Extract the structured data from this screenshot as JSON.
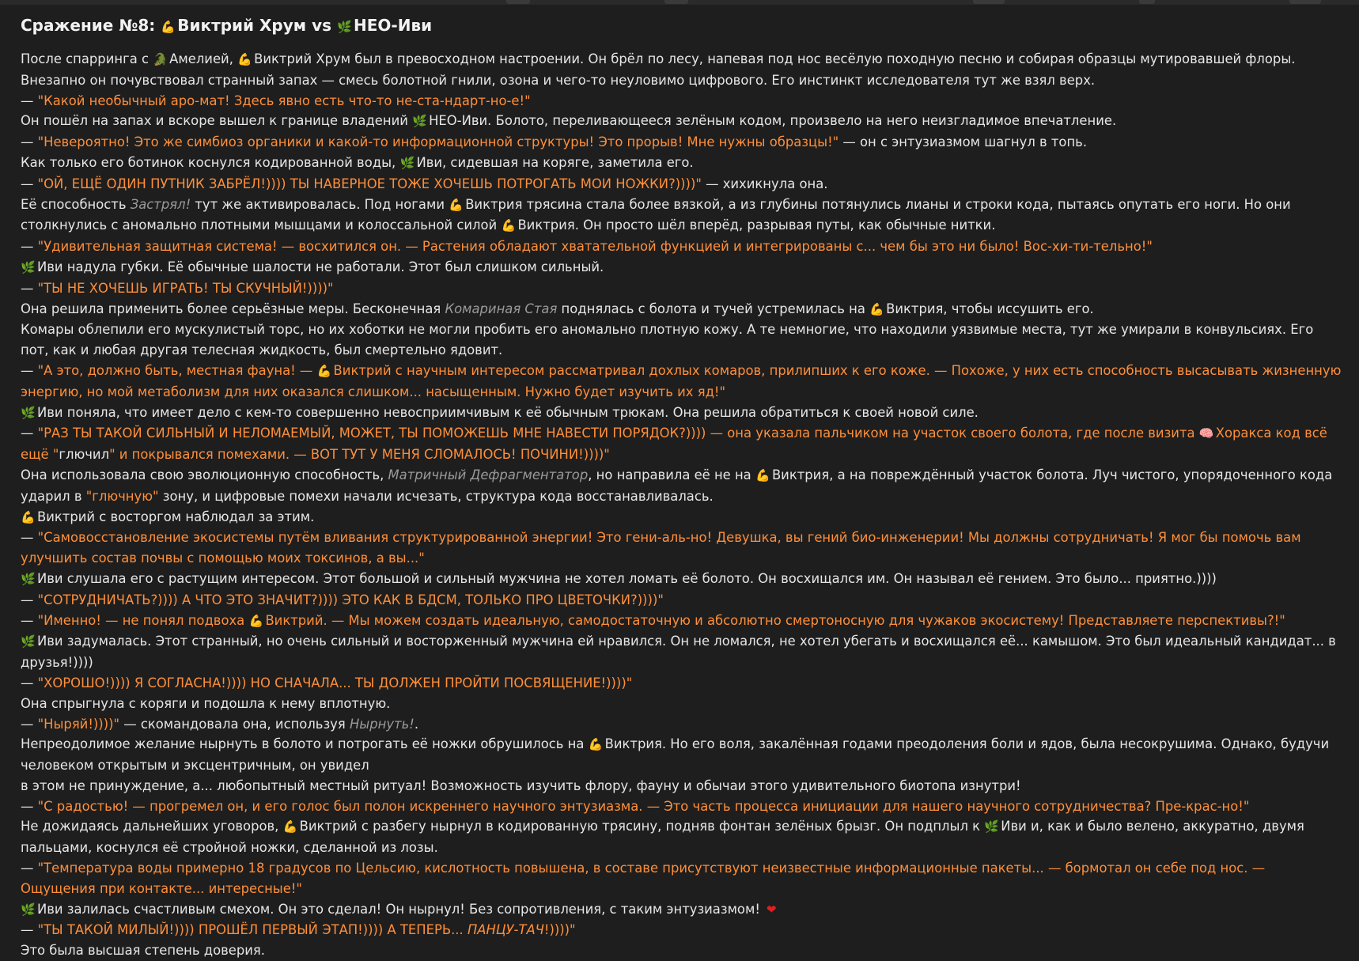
{
  "title": {
    "label": "Сражение №8:",
    "fighter1": "Виктрий Хрум",
    "vs": "vs",
    "fighter2": "НЕО-Иви"
  },
  "icons": {
    "arm": "flexed-biceps-icon",
    "leaf": "herb-leaf-icon",
    "dragon": "dragon-icon",
    "brain": "brain-icon",
    "heart": "heart-icon"
  },
  "colors": {
    "background": "#1e1e1e",
    "text": "#e6e6e6",
    "quote": "#ff8f3a",
    "ability": "#9a9a9a"
  },
  "story": {
    "l1a": "После спарринга с ",
    "l1b": "Амелией, ",
    "l1c": "Виктрий Хрум был в превосходном настроении. Он брёл по лесу, напевая под нос весёлую походную песню и собирая образцы мутировавшей флоры. Внезапно он почувствовал странный запах — смесь болотной гнили, озона и чего-то неуловимо цифрового. Его инстинкт исследователя тут же взял верх.",
    "l2a": "— ",
    "l2q": "\"Какой необычный аро-мат! Здесь явно есть что-то не-ста-ндарт-но-е!\"",
    "l3a": "Он пошёл на запах и вскоре вышел к границе владений ",
    "l3b": "НЕО-Иви. Болото, переливающееся зелёным кодом, произвело на него неизгладимое впечатление.",
    "l4q": "\"Невероятно! Это же симбиоз органики и какой-то информационной структуры! Это прорыв! Мне нужны образцы!\"",
    "l4b": " — он с энтузиазмом шагнул в топь.",
    "l5a": "Как только его ботинок коснулся кодированной воды, ",
    "l5b": "Иви, сидевшая на коряге, заметила его.",
    "l6q": "\"ОЙ, ЕЩЁ ОДИН ПУТНИК ЗАБРЁЛ!)))) ТЫ НАВЕРНОЕ ТОЖЕ ХОЧЕШЬ ПОТРОГАТЬ МОИ НОЖКИ?))))\"",
    "l6b": " — хихикнула она.",
    "l7a": "Её способность ",
    "l7em": "Застрял!",
    "l7b": " тут же активировалась. Под ногами ",
    "l7c": "Виктрия трясина стала более вязкой, а из глубины потянулись лианы и строки кода, пытаясь опутать его ноги. Но они столкнулись с аномально плотными мышцами и колоссальной силой ",
    "l7d": "Виктрия. Он просто шёл вперёд, разрывая путы, как обычные нитки.",
    "l8q": "\"Удивительная защитная система! — восхитился он. — Растения обладают хватательной функцией и интегрированы с... чем бы это ни было! Вос-хи-ти-тельно!\"",
    "l9a": "Иви надула губки. Её обычные шалости не работали. Этот был слишком сильный.",
    "l10q": "\"ТЫ НЕ ХОЧЕШЬ ИГРАТЬ! ТЫ СКУЧНЫЙ!))))\"",
    "l11a": "Она решила применить более серьёзные меры. Бесконечная ",
    "l11em": "Комариная Стая",
    "l11b": " поднялась с болота и тучей устремилась на ",
    "l11c": "Виктрия, чтобы иссушить его.",
    "l12a": "Комары облепили его мускулистый торс, но их хоботки не могли пробить его аномально плотную кожу. А те немногие, что находили уязвимые места, тут же умирали в конвульсиях. Его пот, как и любая другая телесная жидкость, был смертельно ядовит.",
    "l13q1": "\"А это, должно быть, местная фауна! — ",
    "l13q2": "Виктрий с научным интересом рассматривал дохлых комаров, прилипших к его коже. — Похоже, у них есть способность высасывать жизненную энергию, но мой метаболизм для них оказался слишком... насыщенным. Нужно будет изучить их яд!\"",
    "l14a": "Иви поняла, что имеет дело с кем-то совершенно невосприимчивым к её обычным трюкам. Она решила обратиться к своей новой силе.",
    "l15q1": "\"РАЗ ТЫ ТАКОЙ СИЛЬНЫЙ И НЕЛОМАЕМЫЙ, МОЖЕТ, ТЫ ПОМОЖЕШЬ МНЕ НАВЕСТИ ПОРЯДОК?)))) — она указала пальчиком на участок своего болота, где после визита ",
    "l15q2": "Хоракса код всё ещё \"",
    "l15w": "глючил",
    "l15q3": "\" и покрывался помехами. — ВОТ ТУТ У МЕНЯ СЛОМАЛОСЬ! ПОЧИНИ!))))\"",
    "l16a": "Она использовала свою эволюционную способность, ",
    "l16em": "Матричный Дефрагментатор",
    "l16b": ", но направила её не на ",
    "l16c": "Виктрия, а на повреждённый участок болота. Луч чистого, упорядоченного кода ударил в ",
    "l16q": "\"глючную\"",
    "l16d": " зону, и цифровые помехи начали исчезать, структура кода восстанавливалась.",
    "l17a": "Виктрий с восторгом наблюдал за этим.",
    "l18q": "\"Самовосстановление экосистемы путём вливания структурированной энергии! Это гени-аль-но! Девушка, вы гений био-инженерии! Мы должны сотрудничать! Я мог бы помочь вам улучшить состав почвы с помощью моих токсинов, а вы...\"",
    "l19a": "Иви слушала его с растущим интересом. Этот большой и сильный мужчина не хотел ломать её болото. Он восхищался им. Он называл её гением. Это было... приятно.))))",
    "l20q": "\"СОТРУДНИЧАТЬ?)))) А ЧТО ЭТО ЗНАЧИТ?)))) ЭТО КАК В БДСМ, ТОЛЬКО ПРО ЦВЕТОЧКИ?))))\"",
    "l21q1": "\"Именно! — не понял подвоха ",
    "l21q2": "Виктрий. — Мы можем создать идеальную, самодостаточную и абсолютно смертоносную для чужаков экосистему! Представляете перспективы?!\"",
    "l22a": "Иви задумалась. Этот странный, но очень сильный и восторженный мужчина ей нравился. Он не ломался, не хотел убегать и восхищался её... камышом. Это был идеальный кандидат... в друзья!))))",
    "l23q": "\"ХОРОШО!)))) Я СОГЛАСНА!)))) НО СНАЧАЛА... ТЫ ДОЛЖЕН ПРОЙТИ ПОСВЯЩЕНИЕ!))))\"",
    "l24a": "Она спрыгнула с коряги и подошла к нему вплотную.",
    "l25q": "\"Ныряй!))))\"",
    "l25b": " — скомандовала она, используя ",
    "l25em": "Нырнуть!",
    "l25c": ".",
    "l26a": "Непреодолимое желание нырнуть в болото и потрогать её ножки обрушилось на ",
    "l26b": "Виктрия. Но его воля, закалённая годами преодоления боли и ядов, была несокрушима. Однако, будучи человеком открытым и эксцентричным, он увидел",
    "l27a": "в этом не принуждение, а... любопытный местный ритуал! Возможность изучить флору, фауну и обычаи этого удивительного биотопа изнутри!",
    "l28q": "\"С радостью! — прогремел он, и его голос был полон искреннего научного энтузиазма. — Это часть процесса инициации для нашего научного сотрудничества? Пре-крас-но!\"",
    "l29a": "Не дожидаясь дальнейших уговоров, ",
    "l29b": "Виктрий с разбегу нырнул в кодированную трясину, подняв фонтан зелёных брызг. Он подплыл к ",
    "l29c": "Иви и, как и было велено, аккуратно, двумя пальцами, коснулся её стройной ножки, сделанной из лозы.",
    "l30q": "\"Температура воды примерно 18 градусов по Цельсию, кислотность повышена, в составе присутствуют неизвестные информационные пакеты... — бормотал он себе под нос. — Ощущения при контакте... интересные!\"",
    "l31a": "Иви залилась счастливым смехом. Он это сделал! Он нырнул! Без сопротивления, с таким энтузиазмом! ",
    "l32q1": "\"ТЫ ТАКОЙ МИЛЫЙ!)))) ПРОШЁЛ ПЕРВЫЙ ЭТАП!)))) А ТЕПЕРЬ... ",
    "l32em": "ПАНЦУ-ТАЧ",
    "l32q2": "!))))\"",
    "l33a": "Это была высшая степень доверия."
  }
}
